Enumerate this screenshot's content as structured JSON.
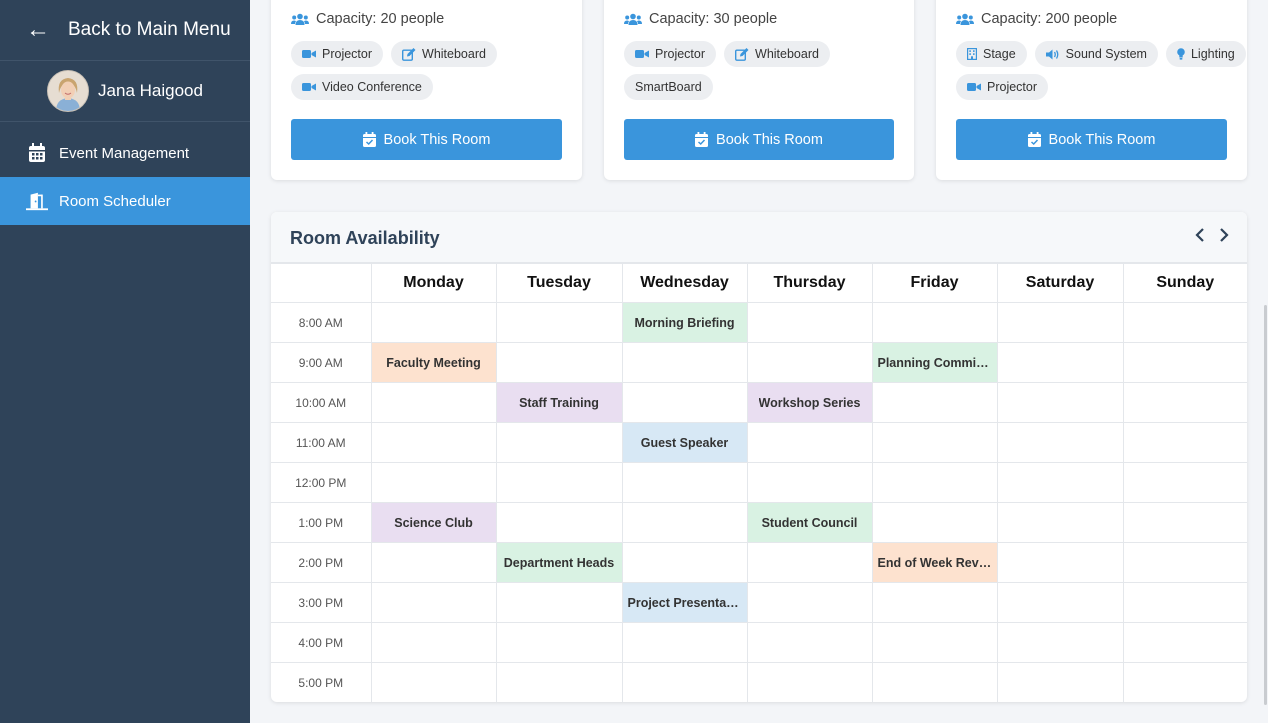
{
  "sidebar": {
    "back_label": "Back to Main Menu",
    "user_name": "Jana Haigood",
    "items": [
      {
        "label": "Event Management",
        "icon": "calendar-icon",
        "active": false
      },
      {
        "label": "Room Scheduler",
        "icon": "door-icon",
        "active": true
      }
    ]
  },
  "rooms": [
    {
      "capacity": "Capacity: 20 people",
      "features": [
        "Projector",
        "Whiteboard",
        "Video Conference"
      ],
      "book_label": "Book This Room"
    },
    {
      "capacity": "Capacity: 30 people",
      "features": [
        "Projector",
        "Whiteboard",
        "SmartBoard"
      ],
      "book_label": "Book This Room"
    },
    {
      "capacity": "Capacity: 200 people",
      "features": [
        "Stage",
        "Sound System",
        "Lighting",
        "Projector"
      ],
      "book_label": "Book This Room"
    }
  ],
  "availability": {
    "title": "Room Availability",
    "days": [
      "Monday",
      "Tuesday",
      "Wednesday",
      "Thursday",
      "Friday",
      "Saturday",
      "Sunday"
    ],
    "times": [
      "8:00 AM",
      "9:00 AM",
      "10:00 AM",
      "11:00 AM",
      "12:00 PM",
      "1:00 PM",
      "2:00 PM",
      "3:00 PM",
      "4:00 PM",
      "5:00 PM"
    ],
    "events": [
      {
        "title": "Morning Briefing",
        "day": 2,
        "time": 0,
        "color": "#d9f2e3"
      },
      {
        "title": "Faculty Meeting",
        "day": 0,
        "time": 1,
        "color": "#fde2cf"
      },
      {
        "title": "Planning Committee",
        "day": 4,
        "time": 1,
        "color": "#d9f2e3"
      },
      {
        "title": "Staff Training",
        "day": 1,
        "time": 2,
        "color": "#e9def1"
      },
      {
        "title": "Workshop Series",
        "day": 3,
        "time": 2,
        "color": "#e9def1"
      },
      {
        "title": "Guest Speaker",
        "day": 2,
        "time": 3,
        "color": "#d7e8f5"
      },
      {
        "title": "Science Club",
        "day": 0,
        "time": 5,
        "color": "#e9def1"
      },
      {
        "title": "Student Council",
        "day": 3,
        "time": 5,
        "color": "#d9f2e3"
      },
      {
        "title": "Department Heads",
        "day": 1,
        "time": 6,
        "color": "#d9f2e3"
      },
      {
        "title": "End of Week Review",
        "day": 4,
        "time": 6,
        "color": "#fde2cf"
      },
      {
        "title": "Project Presentation",
        "day": 2,
        "time": 7,
        "color": "#d7e8f5"
      }
    ]
  },
  "colors": {
    "sidebar": "#2f4359",
    "accent": "#3a95dc"
  }
}
